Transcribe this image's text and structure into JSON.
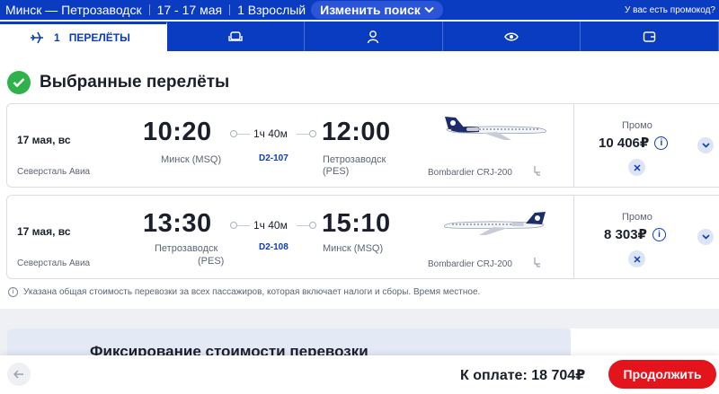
{
  "topbar": {
    "route": "Минск — Петрозаводск",
    "dates": "17 - 17 мая",
    "passengers": "1 Взрослый",
    "change_search": "Изменить поиск",
    "promo_question": "У вас есть промокод?"
  },
  "steps": {
    "active_number": "1",
    "active_label": "ПЕРЕЛЁТЫ",
    "icons": [
      "plane-icon",
      "seat-icon",
      "person-icon",
      "eye-icon",
      "wallet-icon"
    ]
  },
  "section": {
    "title": "Выбранные перелёты"
  },
  "flights": [
    {
      "date": "17 мая, вс",
      "airline": "Северсталь Авиа",
      "dep_time": "10:20",
      "dep_city": "Минск (MSQ)",
      "duration": "1ч 40м",
      "flight_no": "D2-107",
      "arr_time": "12:00",
      "arr_city": "Петрозаводск",
      "arr_code": "(PES)",
      "aircraft": "Bombardier CRJ-200",
      "fare": "Промо",
      "price": "10 406₽"
    },
    {
      "date": "17 мая, вс",
      "airline": "Северсталь Авиа",
      "dep_time": "13:30",
      "dep_city": "Петрозаводск",
      "dep_code": "(PES)",
      "duration": "1ч 40м",
      "flight_no": "D2-108",
      "arr_time": "15:10",
      "arr_city": "Минск (MSQ)",
      "aircraft": "Bombardier CRJ-200",
      "fare": "Промо",
      "price": "8 303₽"
    }
  ],
  "disclaimer": "Указана общая стоимость перевозки за всех пассажиров, которая включает налоги и сборы. Время местное.",
  "teaser": {
    "title": "Фиксирование стоимости перевозки"
  },
  "bottom": {
    "total_label": "К оплате: 18 704₽",
    "continue": "Продолжить"
  },
  "colors": {
    "brand": "#0a3cc2",
    "accent": "#e3141b",
    "success": "#2fb24a"
  }
}
